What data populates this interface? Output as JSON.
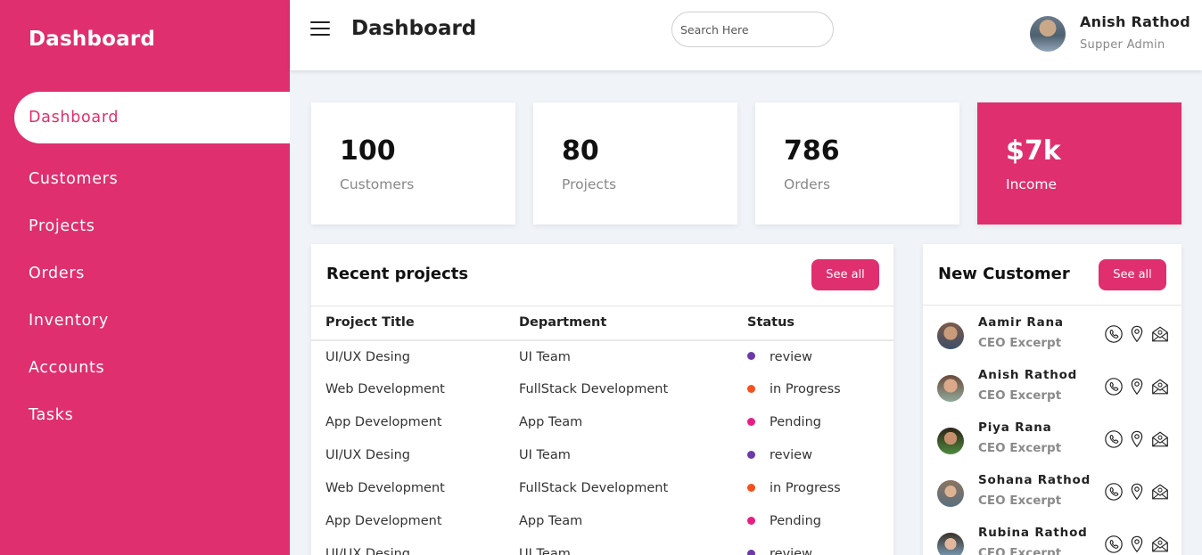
{
  "sidebar": {
    "brand": "Dashboard",
    "items": [
      {
        "label": "Dashboard",
        "active": true
      },
      {
        "label": "Customers"
      },
      {
        "label": "Projects"
      },
      {
        "label": "Orders"
      },
      {
        "label": "Inventory"
      },
      {
        "label": "Accounts"
      },
      {
        "label": "Tasks"
      }
    ]
  },
  "header": {
    "title": "Dashboard",
    "search_placeholder": "Search Here",
    "user": {
      "name": "Anish Rathod",
      "role": "Supper Admin"
    }
  },
  "stats": [
    {
      "value": "100",
      "label": "Customers"
    },
    {
      "value": "80",
      "label": "Projects"
    },
    {
      "value": "786",
      "label": "Orders"
    },
    {
      "value": "$7k",
      "label": "Income"
    }
  ],
  "recent_projects": {
    "title": "Recent projects",
    "see_all": "See all",
    "columns": [
      "Project Title",
      "Department",
      "Status"
    ],
    "rows": [
      {
        "title": "UI/UX Desing",
        "dept": "UI Team",
        "status": "review",
        "status_color": "#6c3aa8"
      },
      {
        "title": "Web Development",
        "dept": "FullStack Development",
        "status": "in Progress",
        "status_color": "#f4511e"
      },
      {
        "title": "App Development",
        "dept": "App Team",
        "status": "Pending",
        "status_color": "#e91e83"
      },
      {
        "title": "UI/UX Desing",
        "dept": "UI Team",
        "status": "review",
        "status_color": "#6c3aa8"
      },
      {
        "title": "Web Development",
        "dept": "FullStack Development",
        "status": "in Progress",
        "status_color": "#f4511e"
      },
      {
        "title": "App Development",
        "dept": "App Team",
        "status": "Pending",
        "status_color": "#e91e83"
      },
      {
        "title": "UI/UX Desing",
        "dept": "UI Team",
        "status": "review",
        "status_color": "#6c3aa8"
      }
    ]
  },
  "new_customers": {
    "title": "New Customer",
    "see_all": "See all",
    "items": [
      {
        "name": "Aamir Rana",
        "role": "CEO Excerpt"
      },
      {
        "name": "Anish Rathod",
        "role": "CEO Excerpt"
      },
      {
        "name": "Piya Rana",
        "role": "CEO Excerpt"
      },
      {
        "name": "Sohana Rathod",
        "role": "CEO Excerpt"
      },
      {
        "name": "Rubina Rathod",
        "role": "CEO Excerpt"
      }
    ]
  },
  "colors": {
    "accent": "#df2f6e",
    "review": "#6c3aa8",
    "in_progress": "#f4511e",
    "pending": "#e91e83"
  }
}
